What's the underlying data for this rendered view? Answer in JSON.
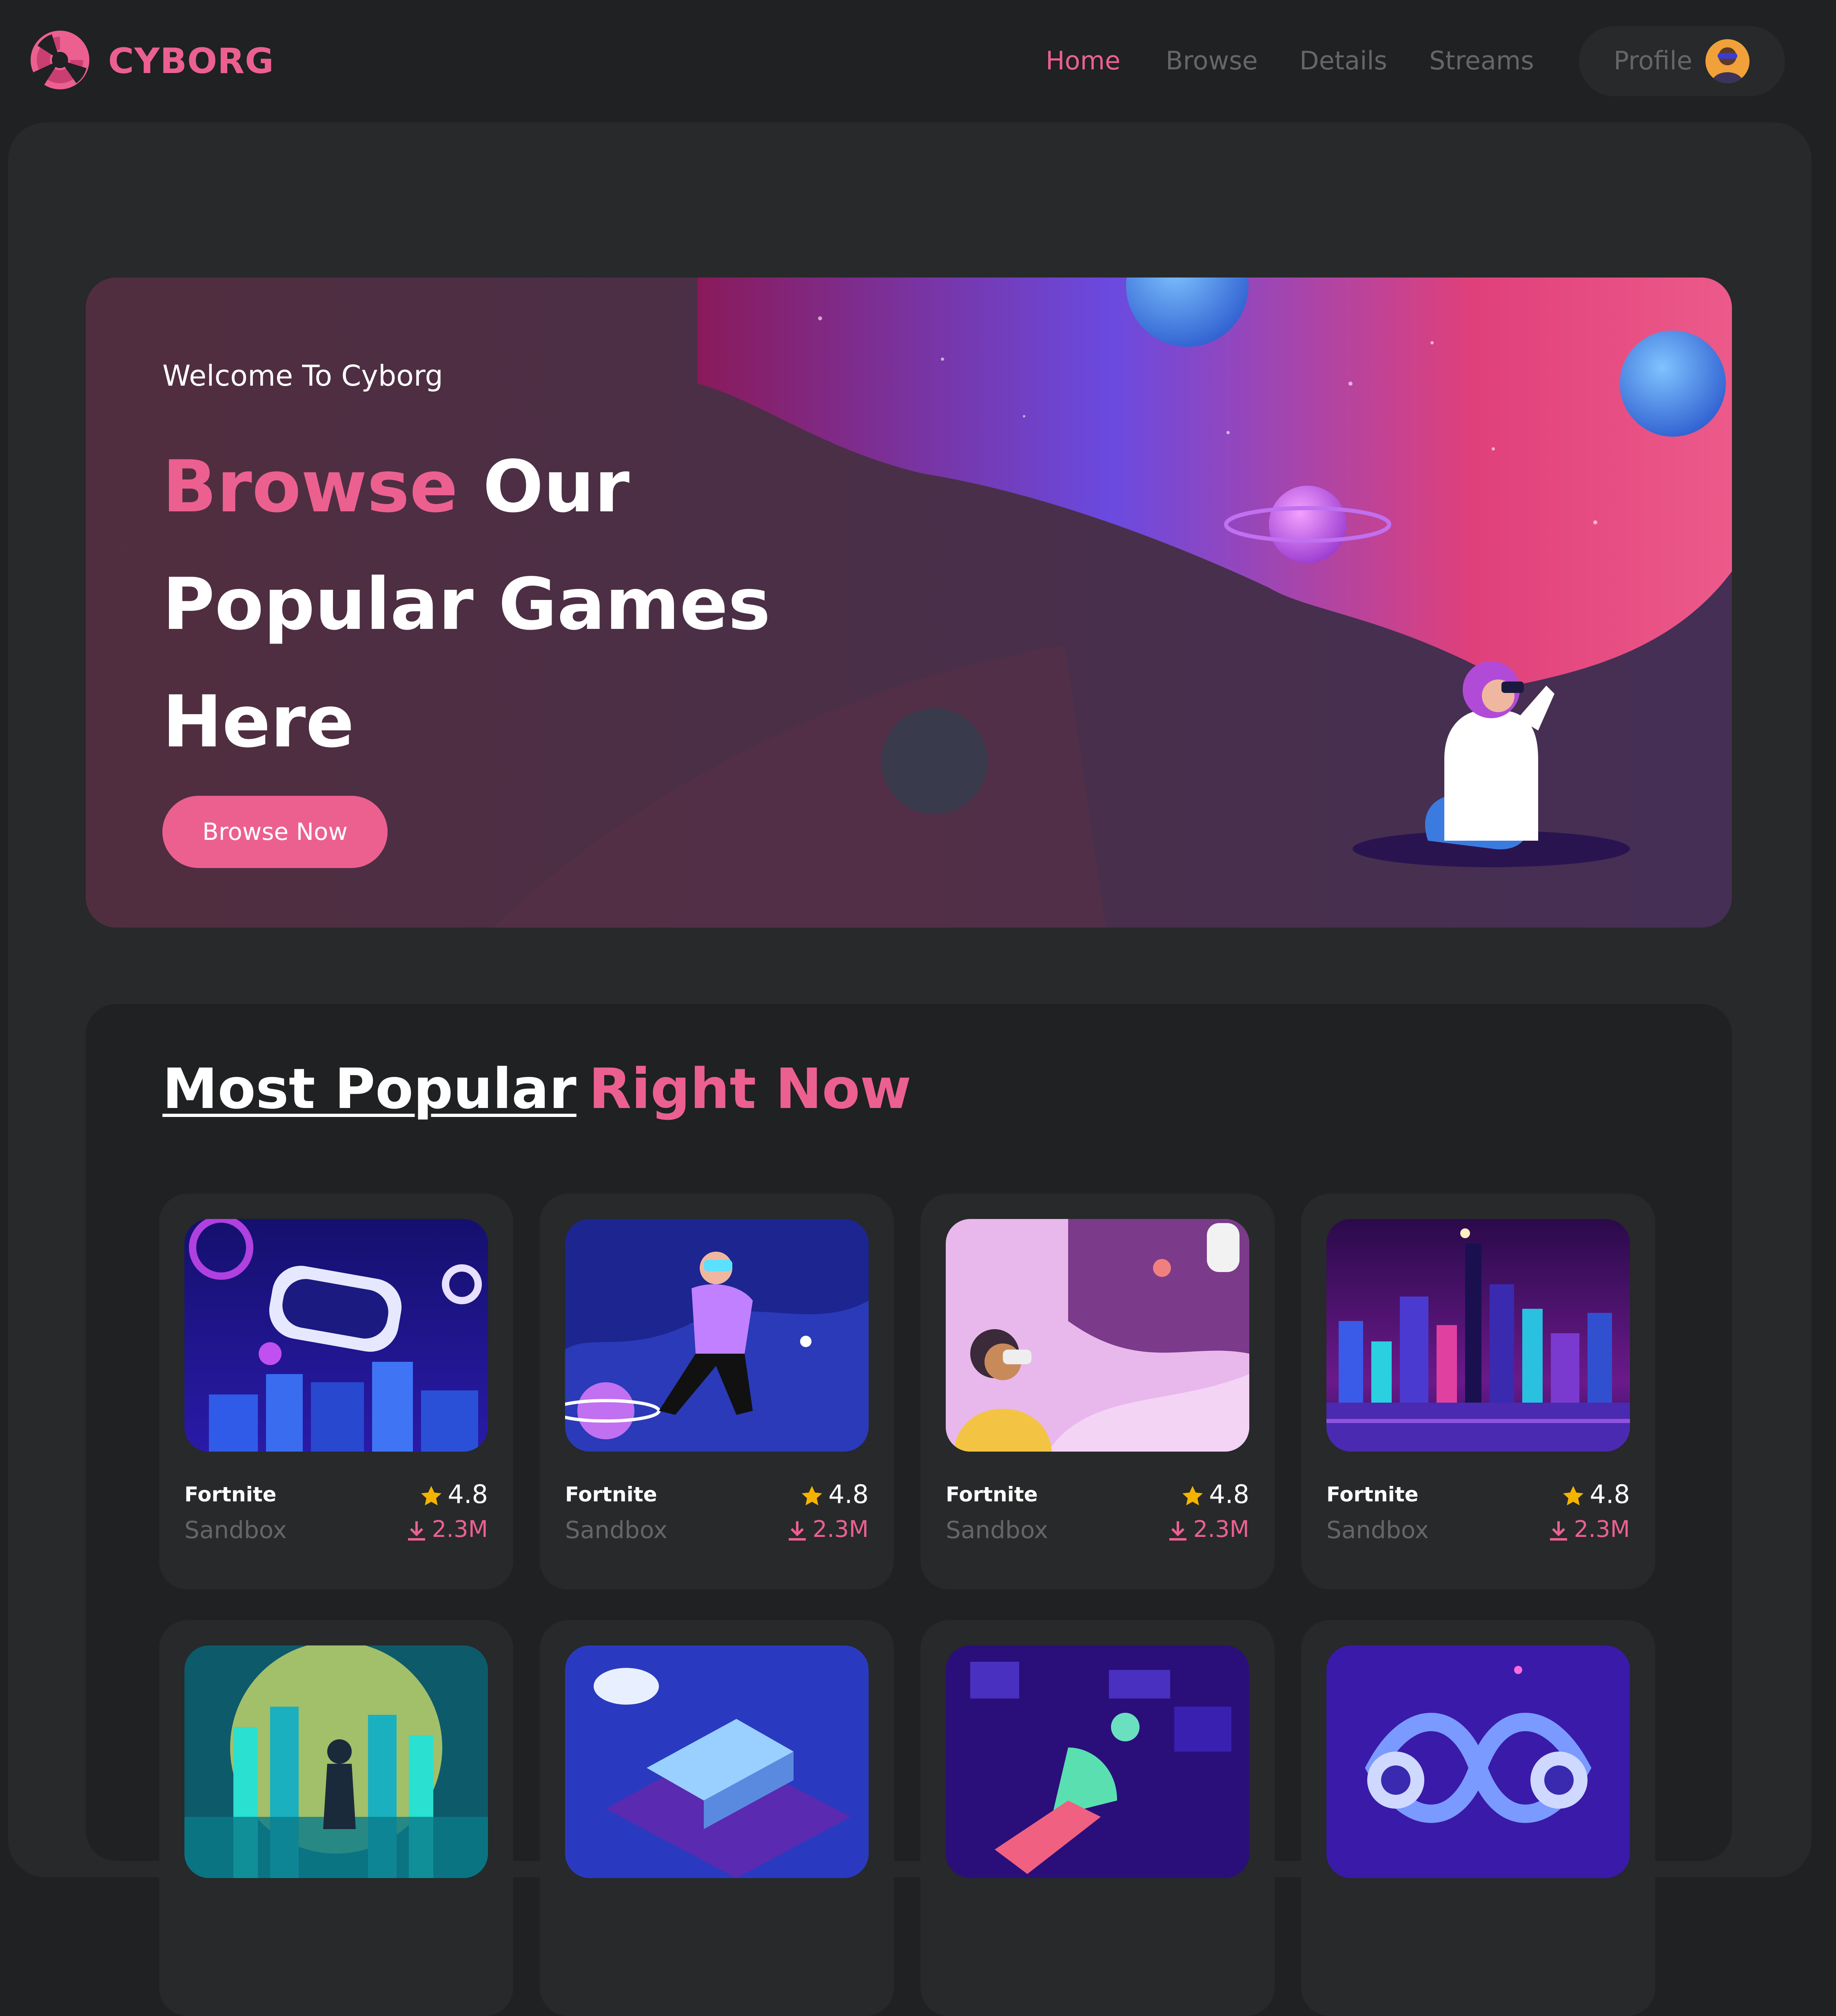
{
  "brand": {
    "name": "CYBORG",
    "accent": "#ec6090",
    "icon": "cyborg-logo-icon"
  },
  "nav": {
    "items": [
      {
        "label": "Home",
        "active": true
      },
      {
        "label": "Browse",
        "active": false
      },
      {
        "label": "Details",
        "active": false
      },
      {
        "label": "Streams",
        "active": false
      }
    ],
    "profile": {
      "label": "Profile",
      "icon": "avatar-icon"
    }
  },
  "hero": {
    "welcome": "Welcome To Cyborg",
    "title_accent": "Browse",
    "title_rest_1": "Our",
    "title_rest_2": "Popular Games",
    "title_rest_3": "Here",
    "button": "Browse Now"
  },
  "popular": {
    "title_main": "Most Popular",
    "title_accent": "Right Now",
    "cards": [
      {
        "title": "Fortnite",
        "subtitle": "Sandbox",
        "rating": "4.8",
        "downloads": "2.3M",
        "image": "vr-headset-city"
      },
      {
        "title": "Fortnite",
        "subtitle": "Sandbox",
        "rating": "4.8",
        "downloads": "2.3M",
        "image": "floating-vr-player"
      },
      {
        "title": "Fortnite",
        "subtitle": "Sandbox",
        "rating": "4.8",
        "downloads": "2.3M",
        "image": "vr-woman-astronaut"
      },
      {
        "title": "Fortnite",
        "subtitle": "Sandbox",
        "rating": "4.8",
        "downloads": "2.3M",
        "image": "neon-skyline"
      },
      {
        "image": "cyber-city-runner"
      },
      {
        "image": "vr-isometric"
      },
      {
        "image": "dashboard-explorer"
      },
      {
        "image": "infinity-robots"
      }
    ]
  },
  "colors": {
    "background": "#1f2122",
    "panel": "#27292a",
    "muted_text": "#666666",
    "star": "#f5b300"
  }
}
